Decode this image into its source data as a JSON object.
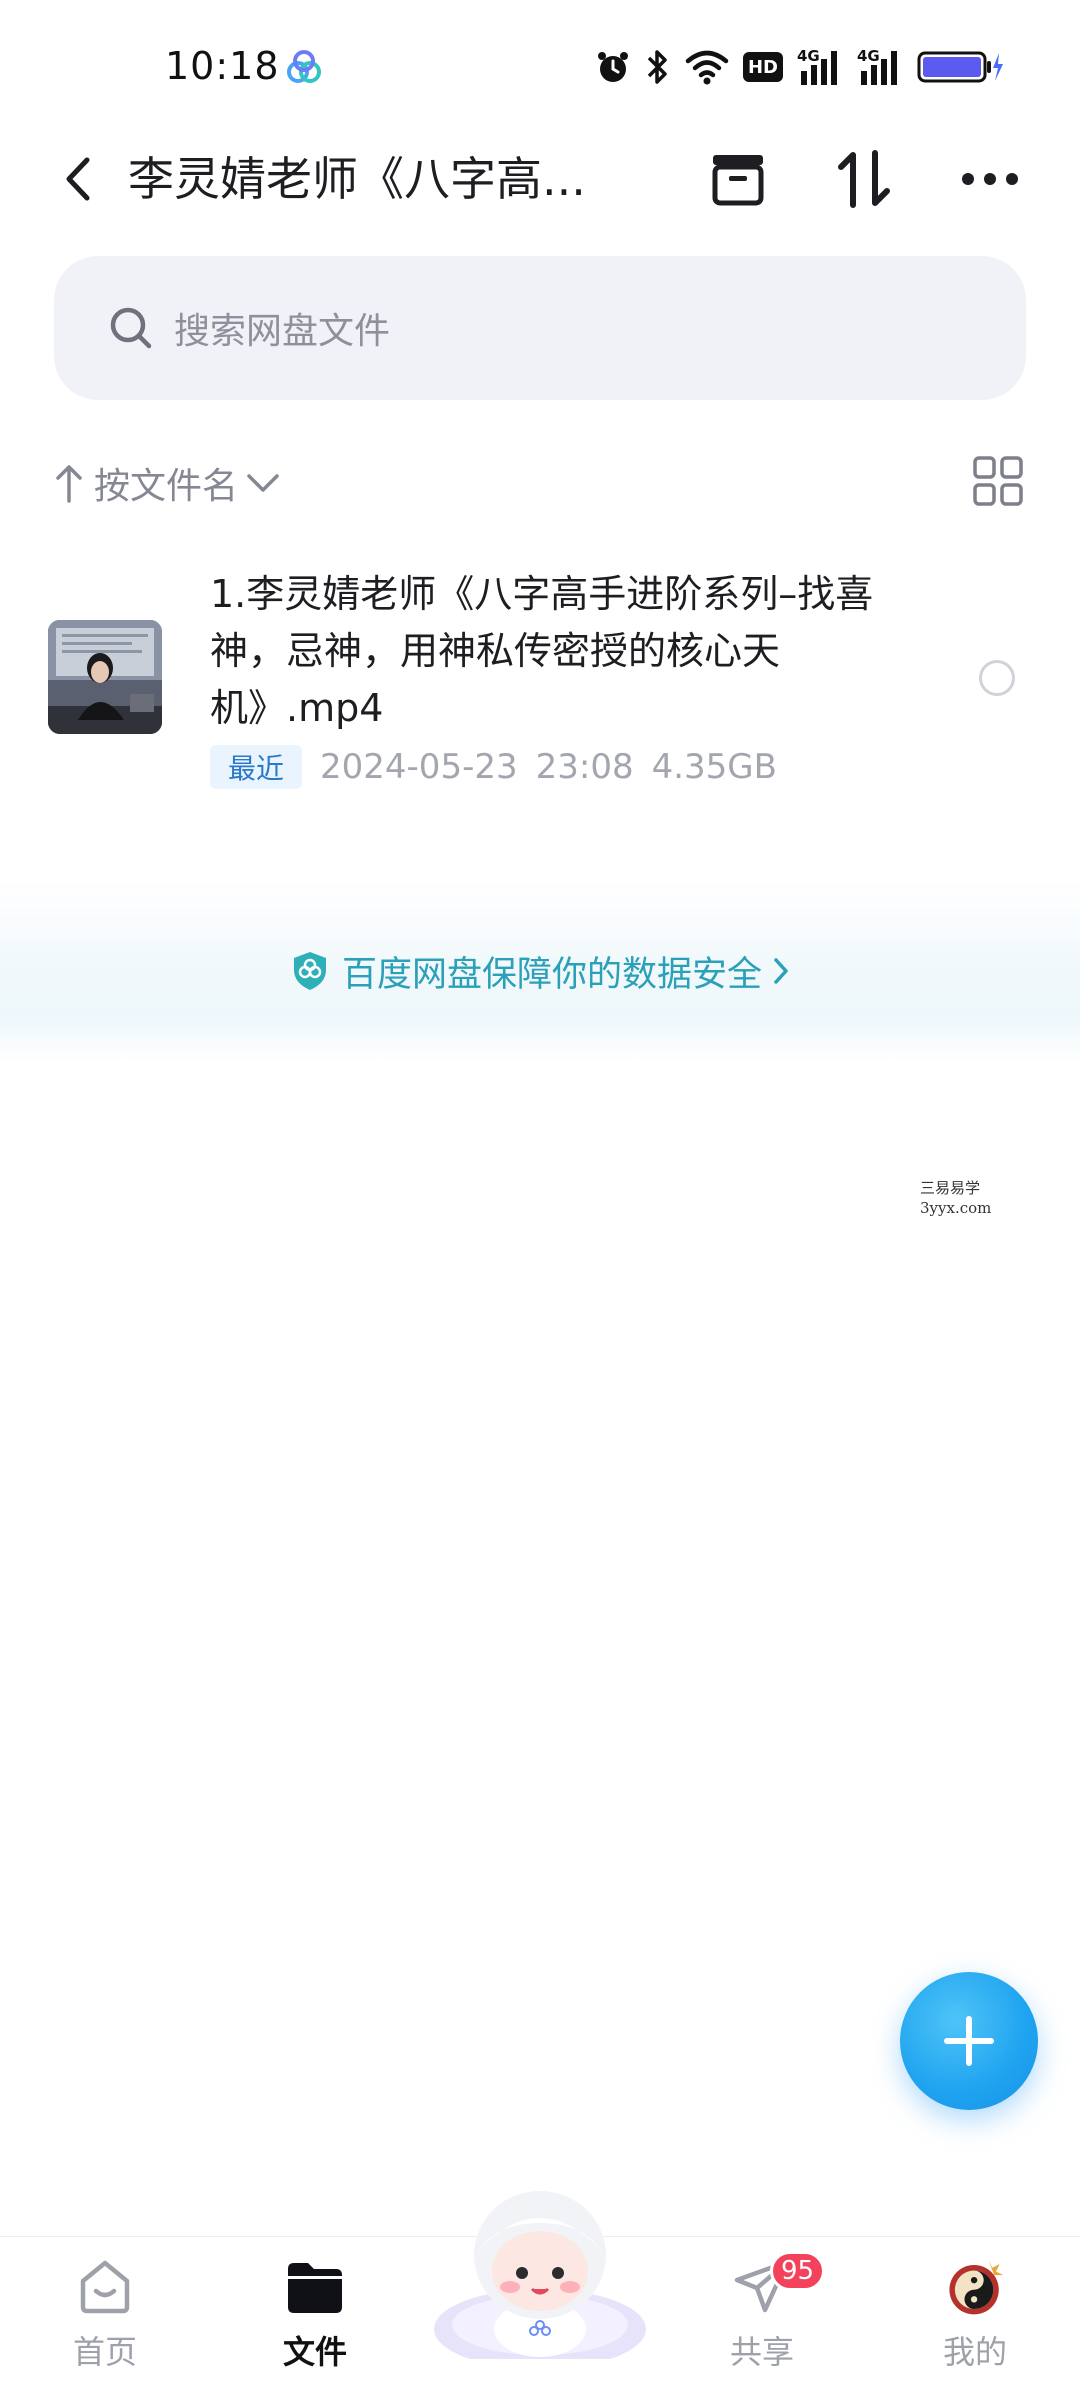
{
  "status_bar": {
    "time": "10:18",
    "network_label": "HD",
    "signal_1": "4G",
    "signal_2": "4G"
  },
  "header": {
    "title": "李灵婧老师《八字高...",
    "icons": [
      "back-icon",
      "archive-icon",
      "sort-order-icon",
      "more-icon"
    ]
  },
  "search": {
    "placeholder": "搜索网盘文件"
  },
  "sort": {
    "label": "按文件名"
  },
  "files": [
    {
      "name": "1.李灵婧老师《八字高手进阶系列–找喜神，忌神，用神私传密授的核心天机》.mp4",
      "badge": "最近",
      "date": "2024-05-23",
      "time": "23:08",
      "size": "4.35GB"
    }
  ],
  "security_banner": {
    "text": "百度网盘保障你的数据安全"
  },
  "watermark": {
    "line1": "三易易学",
    "line2": "3yyx.com"
  },
  "bottom_nav": {
    "items": [
      {
        "label": "首页",
        "icon": "home-icon"
      },
      {
        "label": "文件",
        "icon": "folder-icon",
        "active": true
      },
      {
        "label": "共享",
        "icon": "share-icon",
        "badge": "95"
      },
      {
        "label": "我的",
        "icon": "avatar-icon"
      }
    ]
  },
  "colors": {
    "accent": "#1ea3f0",
    "badge_red": "#f4415c",
    "security_text": "#2aa0b9",
    "search_bg": "#f1f2f7"
  }
}
